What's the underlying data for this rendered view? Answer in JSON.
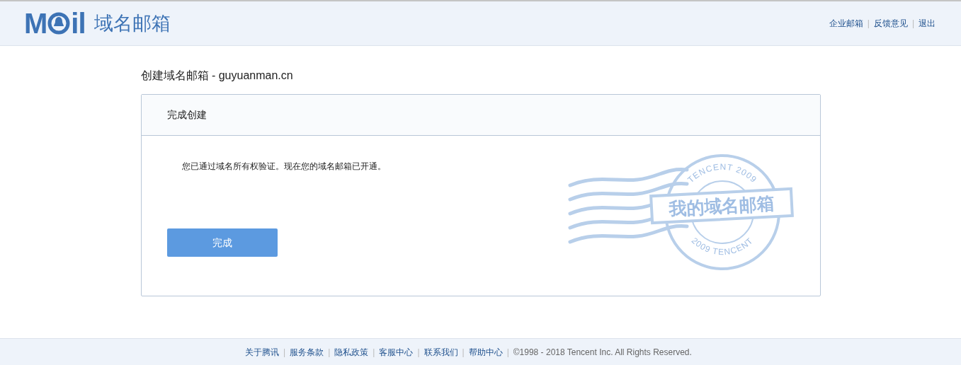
{
  "header": {
    "logo": {
      "left": "M",
      "right": "il"
    },
    "product": "域名邮箱",
    "links": [
      "企业邮箱",
      "反馈意见",
      "退出"
    ],
    "separator": "|"
  },
  "page_title": "创建域名邮箱 - guyuanman.cn",
  "card": {
    "title": "完成创建",
    "message": "您已通过域名所有权验证。现在您的域名邮箱已开通。",
    "button": "完成",
    "stamp": {
      "top_text": "TENCENT 2009",
      "bottom_text": "2009 TENCENT",
      "label": "我的域名邮箱"
    }
  },
  "footer": {
    "links": [
      "关于腾讯",
      "服务条款",
      "隐私政策",
      "客服中心",
      "联系我们",
      "帮助中心"
    ],
    "separator": "|",
    "copyright": "©1998 - 2018 Tencent Inc. All Rights Reserved."
  }
}
